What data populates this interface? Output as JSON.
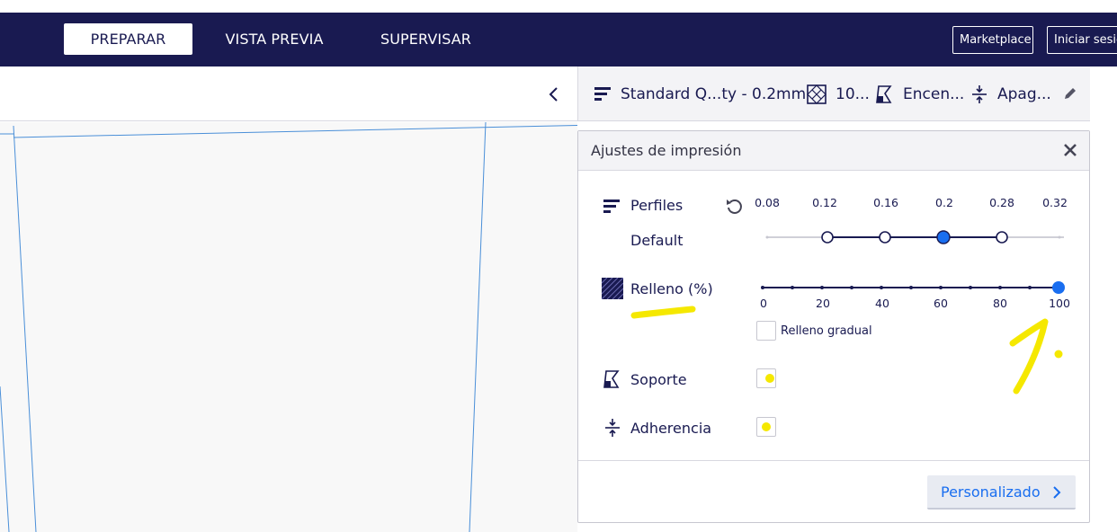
{
  "header": {
    "tabs": [
      {
        "label": "PREPARAR",
        "active": true
      },
      {
        "label": "VISTA PREVIA",
        "active": false
      },
      {
        "label": "SUPERVISAR",
        "active": false
      }
    ],
    "marketplace_label": "Marketplace",
    "signin_label": "Iniciar sesió"
  },
  "print_bar": {
    "profile": "Standard Q...ty - 0.2mm",
    "infill": "10...",
    "support": "Encen...",
    "adhesion": "Apag..."
  },
  "panel": {
    "title": "Ajustes de impresión",
    "profiles": {
      "label": "Perfiles",
      "sublabel": "Default",
      "layer_heights": [
        "0.08",
        "0.12",
        "0.16",
        "0.2",
        "0.28",
        "0.32"
      ],
      "selected": "0.2"
    },
    "infill": {
      "label": "Relleno (%)",
      "ticks": [
        "0",
        "20",
        "40",
        "60",
        "80",
        "100"
      ],
      "value": 100,
      "gradual_label": "Relleno gradual",
      "gradual_checked": false
    },
    "support": {
      "label": "Soporte",
      "checked": true
    },
    "adhesion": {
      "label": "Adherencia",
      "checked": true
    },
    "custom_button": "Personalizado"
  },
  "annotation": {
    "handwritten_mark": "1."
  },
  "colors": {
    "header_bg": "#191a51",
    "accent": "#196ef0",
    "highlight": "#f5e800"
  }
}
